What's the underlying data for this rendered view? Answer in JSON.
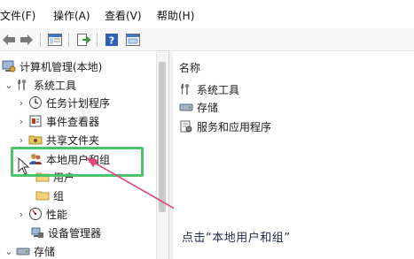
{
  "menu": {
    "file": "文件(F)",
    "action": "操作(A)",
    "view": "查看(V)",
    "help": "帮助(H)"
  },
  "toolbar": {
    "back": "back-arrow-icon",
    "forward": "forward-arrow-icon",
    "show_tree": "console-tree-icon",
    "export": "export-list-icon",
    "help": "help-icon",
    "properties": "properties-icon"
  },
  "tree": {
    "root": "计算机管理(本地)",
    "system_tools": "系统工具",
    "task_scheduler": "任务计划程序",
    "event_viewer": "事件查看器",
    "shared_folders": "共享文件夹",
    "local_users_groups": "本地用户和组",
    "users": "用户",
    "groups": "组",
    "performance": "性能",
    "device_manager": "设备管理器",
    "storage": "存储"
  },
  "content": {
    "column_name": "名称",
    "items": [
      "系统工具",
      "存储",
      "服务和应用程序"
    ]
  },
  "caption": "点击“本地用户和组”",
  "colors": {
    "highlight": "#4cc26a",
    "arrow": "#e0457e",
    "caption_text": "#1e2a4a"
  }
}
